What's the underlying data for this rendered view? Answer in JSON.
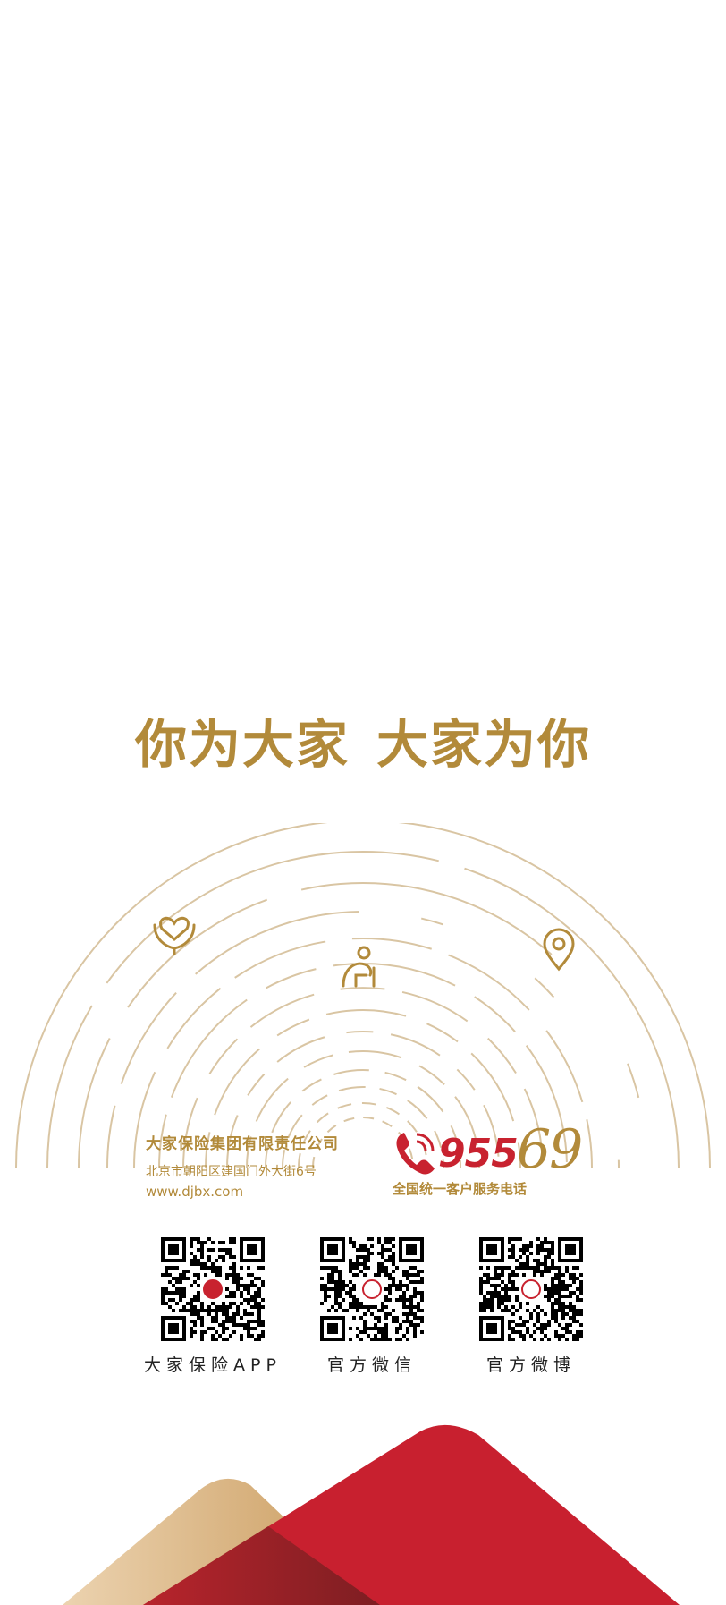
{
  "slogan": {
    "left": "你为大家",
    "right": "大家为你"
  },
  "company": {
    "name": "大家保险集团有限责任公司",
    "address": "北京市朝阳区建国门外大街6号",
    "website": "www.djbx.com"
  },
  "hotline": {
    "number_part1": "955",
    "number_part2": "69",
    "caption": "全国统一客户服务电话"
  },
  "qr_codes": [
    {
      "label": "大家保险APP"
    },
    {
      "label": "官方微信"
    },
    {
      "label": "官方微博"
    }
  ],
  "icons": [
    "heart-hands-icon",
    "elderly-person-icon",
    "location-pin-icon",
    "phone-icon"
  ],
  "colors": {
    "gold": "#b28a3a",
    "arc_gold": "#d9c5a3",
    "red": "#c8222f",
    "dark_red": "#8f1f24",
    "light_gold": "#e8c79a"
  }
}
